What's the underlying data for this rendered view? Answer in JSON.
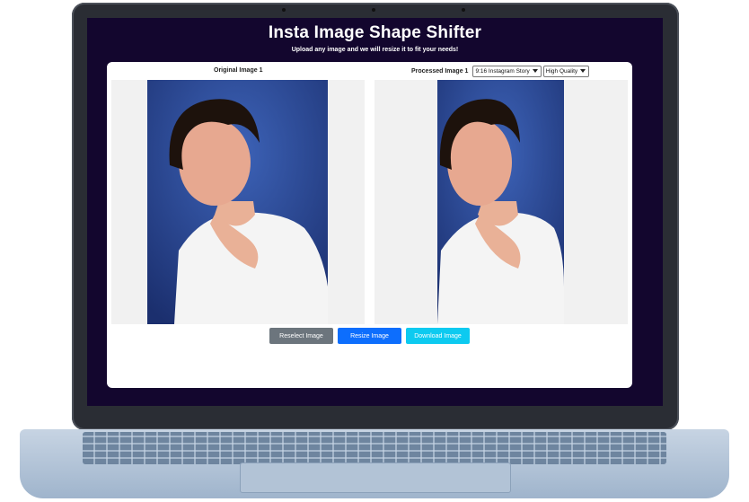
{
  "app": {
    "title": "Insta Image Shape Shifter",
    "subtitle": "Upload any image and we will resize it to fit your needs!"
  },
  "original": {
    "heading": "Original Image 1"
  },
  "processed": {
    "heading": "Processed Image 1",
    "aspect_select": "9:16 Instagram Story",
    "quality_select": "High Quality"
  },
  "buttons": {
    "reselect": "Reselect Image",
    "resize": "Resize Image",
    "download": "Download Image"
  },
  "colors": {
    "screen_bg": "#13062e",
    "reselect": "#6c757d",
    "resize": "#0d6efd",
    "download": "#0dcaf0"
  }
}
